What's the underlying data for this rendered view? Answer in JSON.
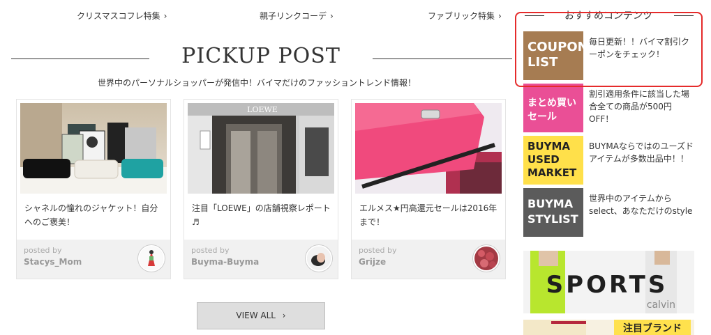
{
  "top_links": [
    "クリスマスコフレ特集",
    "親子リンクコーデ",
    "ファブリック特集"
  ],
  "pickup": {
    "title": "PICKUP POST",
    "subtitle": "世界中のパーソナルショッパーが発信中！バイマだけのファッショントレンド情報！"
  },
  "cards": [
    {
      "title": "シャネルの憧れのジャケット！自分へのご褒美！",
      "posted": "posted by",
      "author": "Stacys_Mom"
    },
    {
      "title": "注目「LOEWE」の店舗視察レポート♬",
      "posted": "posted by",
      "author": "Buyma-Buyma"
    },
    {
      "title": "エルメス★円高還元セールは2016年まで！",
      "posted": "posted by",
      "author": "Grijze"
    }
  ],
  "card_images": {
    "store_sign": "LOEWE"
  },
  "view_all": "VIEW ALL",
  "sidebar": {
    "heading": "おすすめコンテンツ",
    "items": [
      {
        "badge_line1": "COUPON",
        "badge_line2": "LIST",
        "badge_line3": "",
        "desc": "毎日更新！！バイマ割引クーポンをチェック！",
        "color": "#a67c52"
      },
      {
        "badge_line1": "まとめ買い",
        "badge_line2": "セール",
        "badge_line3": "",
        "desc": "割引適用条件に該当した場合全ての商品が500円OFF！",
        "color": "#ea4f96"
      },
      {
        "badge_line1": "BUYMA",
        "badge_line2": "USED",
        "badge_line3": "MARKET",
        "desc": "BUYMAならではのユーズドアイテムが多数出品中！！",
        "color": "#ffe04a"
      },
      {
        "badge_line1": "BUYMA",
        "badge_line2": "STYLIST",
        "badge_line3": "",
        "desc": "世界中のアイテムからselect、あなただけのstyle",
        "color": "#5b5b5b"
      }
    ],
    "banner1": {
      "title": "SPORTS",
      "sub": "calvin"
    },
    "banner2": {
      "label": "注目ブランド"
    }
  },
  "colors": {
    "highlight": "#e52b2b",
    "button_bg": "#dedede"
  }
}
